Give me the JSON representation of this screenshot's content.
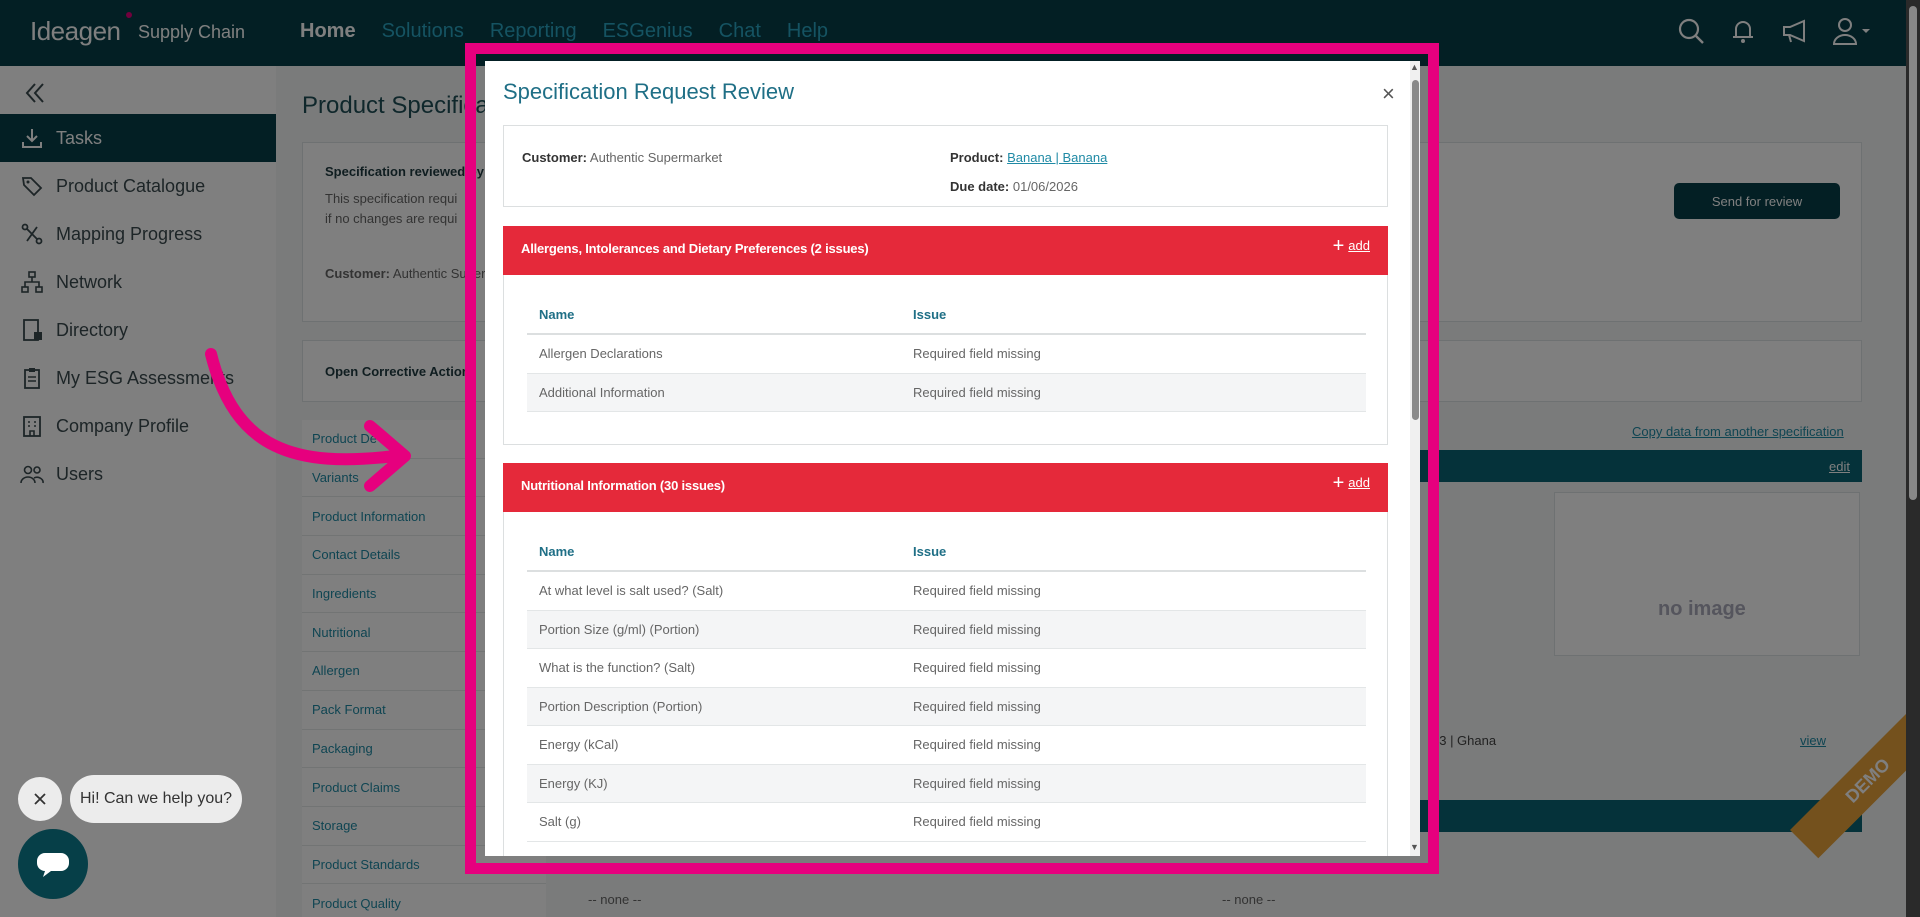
{
  "header": {
    "logo": "Ideagen",
    "logo_sub": "Supply Chain",
    "nav": [
      "Home",
      "Solutions",
      "Reporting",
      "ESGenius",
      "Chat",
      "Help"
    ],
    "icons": [
      "search-icon",
      "bell-icon",
      "megaphone-icon",
      "user-icon"
    ]
  },
  "sidebar": {
    "items": [
      {
        "label": "Tasks",
        "icon": "download-icon",
        "active": true
      },
      {
        "label": "Product Catalogue",
        "icon": "tag-icon"
      },
      {
        "label": "Mapping Progress",
        "icon": "route-icon"
      },
      {
        "label": "Network",
        "icon": "network-icon"
      },
      {
        "label": "Directory",
        "icon": "directory-icon"
      },
      {
        "label": "My ESG Assessments",
        "icon": "clipboard-icon"
      },
      {
        "label": "Company Profile",
        "icon": "building-icon"
      },
      {
        "label": "Users",
        "icon": "users-icon"
      }
    ]
  },
  "background_page": {
    "title": "Product Specifica",
    "reviewed_title": "Specification reviewed by",
    "reviewed_line1": "This specification requi",
    "reviewed_line2": "if no changes are requi",
    "customer_label": "Customer:",
    "customer_value": "Authentic Super",
    "send_button": "Send for review",
    "corrective": "Open Corrective Action",
    "copy_link": "Copy data from another specification",
    "edit": "edit",
    "no_image": "no image",
    "ghana": "93 | Ghana",
    "view": "view",
    "none": "-- none --",
    "toc": [
      "Product De",
      "Variants",
      "Product Information",
      "Contact Details",
      "Ingredients",
      "Nutritional",
      "Allergen",
      "Pack Format",
      "Packaging",
      "Product Claims",
      "Storage",
      "Product Standards",
      "Product Quality"
    ],
    "demo": "DEMO"
  },
  "chat": {
    "bubble": "Hi! Can we help you?"
  },
  "modal": {
    "title": "Specification Request Review",
    "close": "×",
    "customer_label": "Customer:",
    "customer_value": "Authentic Supermarket",
    "product_label": "Product:",
    "product_value": "Banana | Banana",
    "due_label": "Due date:",
    "due_value": "01/06/2026",
    "add_label": "add",
    "col_name": "Name",
    "col_issue": "Issue",
    "sections": [
      {
        "title": "Allergens, Intolerances and Dietary Preferences (2 issues)",
        "rows": [
          {
            "name": "Allergen Declarations",
            "issue": "Required field missing"
          },
          {
            "name": "Additional Information",
            "issue": "Required field missing"
          }
        ]
      },
      {
        "title": "Nutritional Information (30 issues)",
        "rows": [
          {
            "name": "At what level is salt used? (Salt)",
            "issue": "Required field missing"
          },
          {
            "name": "Portion Size (g/ml) (Portion)",
            "issue": "Required field missing"
          },
          {
            "name": "What is the function? (Salt)",
            "issue": "Required field missing"
          },
          {
            "name": "Portion Description (Portion)",
            "issue": "Required field missing"
          },
          {
            "name": "Energy (kCal)",
            "issue": "Required field missing"
          },
          {
            "name": "Energy (KJ)",
            "issue": "Required field missing"
          },
          {
            "name": "Salt (g)",
            "issue": "Required field missing"
          }
        ]
      }
    ]
  },
  "colors": {
    "header_bg": "#063f48",
    "accent_teal": "#1f6f86",
    "section_red": "#e5293a",
    "highlight_pink": "#e6007e"
  }
}
